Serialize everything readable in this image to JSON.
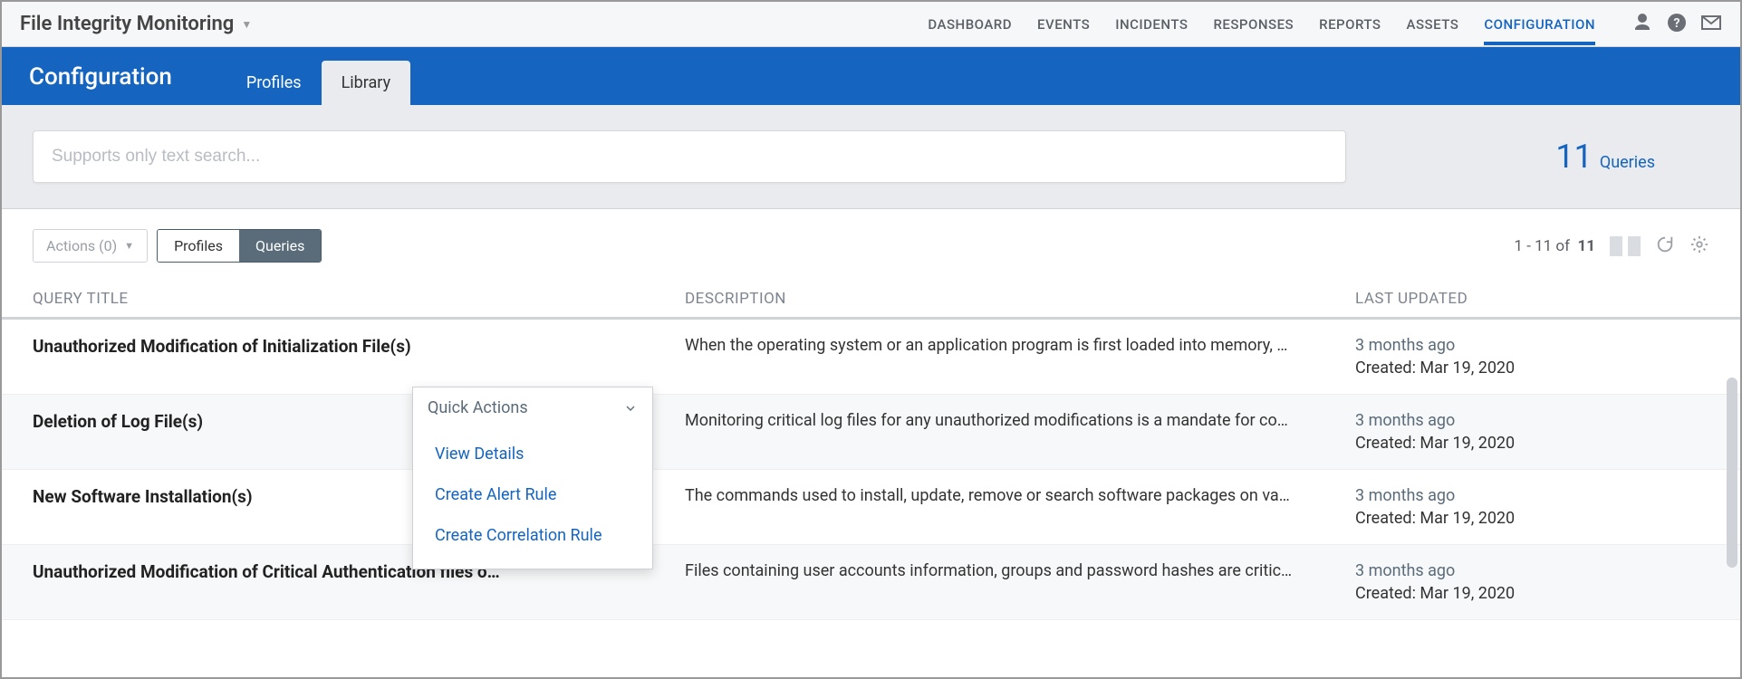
{
  "app": {
    "title": "File Integrity Monitoring"
  },
  "topnav": {
    "items": [
      "DASHBOARD",
      "EVENTS",
      "INCIDENTS",
      "RESPONSES",
      "REPORTS",
      "ASSETS",
      "CONFIGURATION"
    ],
    "active_index": 6
  },
  "subheader": {
    "title": "Configuration",
    "tabs": [
      "Profiles",
      "Library"
    ],
    "active_index": 1
  },
  "search": {
    "placeholder": "Supports only text search..."
  },
  "count": {
    "value": "11",
    "label": "Queries"
  },
  "toolbar": {
    "actions_label": "Actions (0)",
    "segments": [
      "Profiles",
      "Queries"
    ],
    "active_segment": 1,
    "pager_text_prefix": "1 - 11 of",
    "pager_total": "11"
  },
  "columns": {
    "title": "QUERY TITLE",
    "desc": "DESCRIPTION",
    "updated": "LAST UPDATED"
  },
  "rows": [
    {
      "title": "Unauthorized Modification of Initialization File(s)",
      "desc": "When the operating system or an application program is first loaded into memory, …",
      "ago": "3 months ago",
      "created": "Created: Mar 19, 2020"
    },
    {
      "title": "Deletion of Log File(s)",
      "desc": "Monitoring critical log files for any unauthorized modifications is a mandate for co…",
      "ago": "3 months ago",
      "created": "Created: Mar 19, 2020"
    },
    {
      "title": "New Software Installation(s)",
      "desc": "The commands used to install, update, remove or search software packages on va…",
      "ago": "3 months ago",
      "created": "Created: Mar 19, 2020"
    },
    {
      "title": "Unauthorized Modification of Critical Authentication files o…",
      "desc": "Files containing user accounts information, groups and password hashes are critic…",
      "ago": "3 months ago",
      "created": "Created: Mar 19, 2020"
    }
  ],
  "popover": {
    "header": "Quick Actions",
    "items": [
      "View Details",
      "Create Alert Rule",
      "Create Correlation Rule"
    ]
  }
}
